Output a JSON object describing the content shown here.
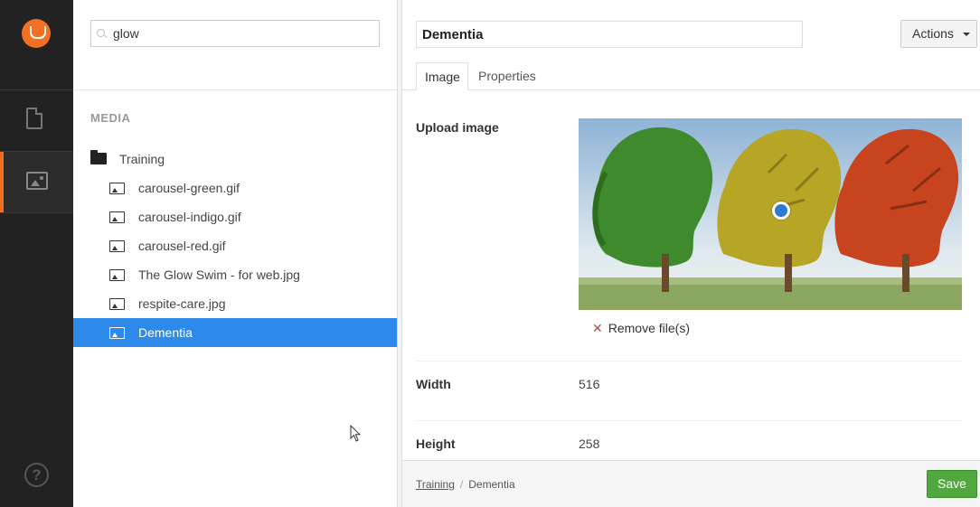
{
  "search": {
    "value": "glow"
  },
  "tree": {
    "heading": "MEDIA",
    "folder": "Training",
    "items": [
      {
        "label": "carousel-green.gif"
      },
      {
        "label": "carousel-indigo.gif"
      },
      {
        "label": "carousel-red.gif"
      },
      {
        "label": "The Glow Swim - for web.jpg"
      },
      {
        "label": "respite-care.jpg"
      },
      {
        "label": "Dementia",
        "selected": true
      }
    ]
  },
  "editor": {
    "name": "Dementia",
    "actions_label": "Actions",
    "tabs": [
      {
        "label": "Image"
      },
      {
        "label": "Properties"
      }
    ],
    "upload_label": "Upload image",
    "remove_label": "Remove file(s)",
    "width_label": "Width",
    "width_value": "516",
    "height_label": "Height",
    "height_value": "258"
  },
  "footer": {
    "crumb_parent": "Training",
    "crumb_current": "Dementia",
    "save_label": "Save"
  },
  "colors": {
    "accent": "#f36f21",
    "selected": "#2e8aea",
    "save": "#50a83f"
  }
}
